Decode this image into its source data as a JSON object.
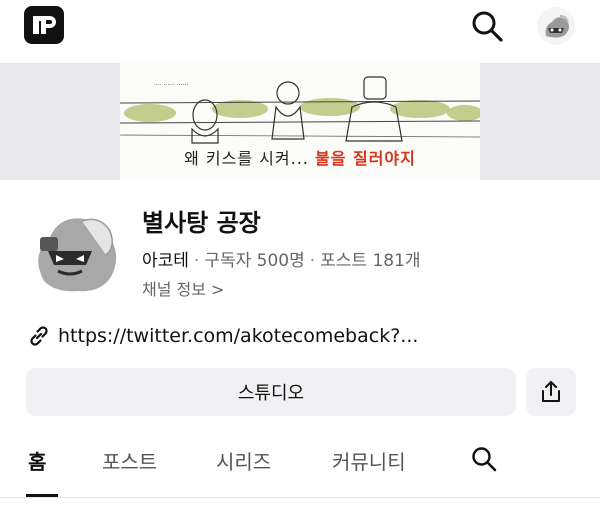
{
  "topbar": {
    "logo_text": "TP",
    "logo_icon": "postype-logo-icon",
    "search_icon": "search-icon",
    "avatar_icon": "profile-avatar"
  },
  "banner": {
    "caption_start": "왜 키스를 시켜... ",
    "caption_fire": "불을 질러야지"
  },
  "channel": {
    "name": "별사탕 공장",
    "author": "아코테",
    "subscribers": "구독자 500명",
    "posts": "포스트 181개",
    "separator": "·",
    "info_link": "채널 정보",
    "info_chevron": ">",
    "link_url": "https://twitter.com/akotecomeback?..."
  },
  "actions": {
    "studio_label": "스튜디오",
    "share_icon": "share-icon"
  },
  "tabs": [
    {
      "label": "홈",
      "active": true
    },
    {
      "label": "포스트",
      "active": false
    },
    {
      "label": "시리즈",
      "active": false
    },
    {
      "label": "커뮤니티",
      "active": false
    }
  ],
  "colors": {
    "accent_text": "#111111",
    "secondary_text": "#666666",
    "button_bg": "#f1f1f4",
    "fire": "#d8341b"
  }
}
